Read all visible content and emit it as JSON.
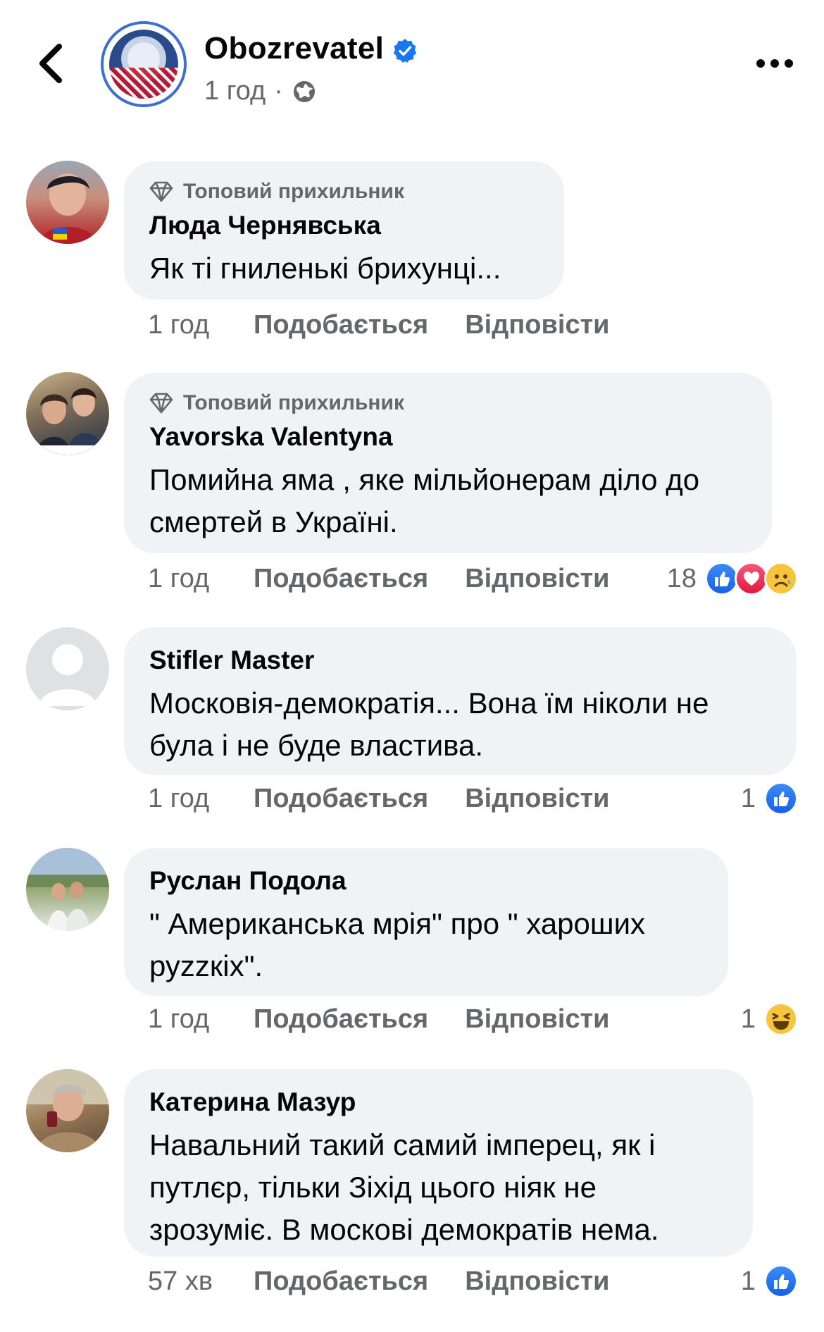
{
  "header": {
    "page_name": "Obozrevatel",
    "time": "1 год",
    "separator": "·",
    "icons": {
      "back": "chevron-left-icon",
      "verified": "verified-badge-icon",
      "audience": "globe-icon",
      "more": "more-horizontal-icon"
    }
  },
  "labels": {
    "like": "Подобається",
    "reply": "Відповісти",
    "top_fan": "Топовий прихильник"
  },
  "comments": [
    {
      "author": "Люда Чернявська",
      "badge": "Топовий прихильник",
      "text": "Як ті гниленькі брихунці...",
      "time": "1 год",
      "reactions": {
        "count": "",
        "types": []
      }
    },
    {
      "author": "Yavorska Valentyna",
      "badge": "Топовий прихильник",
      "text": "Помийна яма , яке мільйонерам діло до смертей в Україні.",
      "time": "1 год",
      "reactions": {
        "count": "18",
        "types": [
          "like",
          "love",
          "sad"
        ]
      }
    },
    {
      "author": "Stifler Master",
      "text": "Московія-демократія... Вона їм ніколи не була і не буде властива.",
      "time": "1 год",
      "reactions": {
        "count": "1",
        "types": [
          "like"
        ]
      }
    },
    {
      "author": "Руслан Подола",
      "text": "\" Американська мрія\" про \" хароших руzzкіх\".",
      "time": "1 год",
      "reactions": {
        "count": "1",
        "types": [
          "haha"
        ]
      }
    },
    {
      "author": "Катерина Мазур",
      "text": "Навальний такий самий імперец, як і путлєр, тільки Зіхід цього ніяк не зрозуміє. В москові демократів нема.",
      "time": "57 хв",
      "reactions": {
        "count": "1",
        "types": [
          "like"
        ]
      }
    }
  ],
  "colors": {
    "bubble": "#f0f2f5",
    "secondary_text": "#65676b",
    "primary_text": "#050505",
    "facebook_blue": "#1877f2"
  }
}
